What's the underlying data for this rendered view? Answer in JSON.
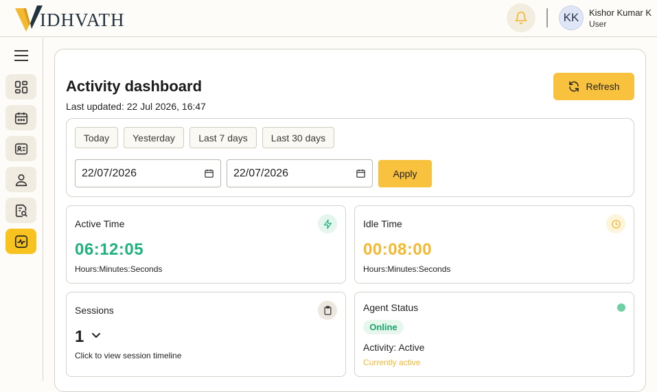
{
  "brand": {
    "logo_text": "IDHVATH",
    "logo_initial": "V"
  },
  "header": {
    "notifications_icon": "bell-icon",
    "user": {
      "initials": "KK",
      "name": "Kishor Kumar K",
      "role": "User"
    }
  },
  "sidebar": {
    "menu_icon": "hamburger-icon",
    "items": [
      {
        "icon": "dashboard-grid-icon",
        "active": false
      },
      {
        "icon": "calendar-icon",
        "active": false
      },
      {
        "icon": "id-card-icon",
        "active": false
      },
      {
        "icon": "user-icon",
        "active": false
      },
      {
        "icon": "report-search-icon",
        "active": false
      },
      {
        "icon": "activity-pulse-icon",
        "active": true
      }
    ]
  },
  "page": {
    "title": "Activity dashboard",
    "last_updated": "Last updated: 22 Jul 2026, 16:47",
    "refresh_label": "Refresh"
  },
  "filters": {
    "quick_ranges": [
      "Today",
      "Yesterday",
      "Last 7 days",
      "Last 30 days"
    ],
    "start_date": "22/07/2026",
    "end_date": "22/07/2026",
    "apply_label": "Apply"
  },
  "cards": {
    "active_time": {
      "label": "Active Time",
      "value": "06:12:05",
      "unit": "Hours:Minutes:Seconds",
      "icon": "lightning-icon"
    },
    "idle_time": {
      "label": "Idle Time",
      "value": "00:08:00",
      "unit": "Hours:Minutes:Seconds",
      "icon": "clock-icon"
    },
    "sessions": {
      "label": "Sessions",
      "value": "1",
      "hint": "Click to view session timeline",
      "icon": "clipboard-icon"
    },
    "agent_status": {
      "label": "Agent Status",
      "badge": "Online",
      "activity": "Activity: Active",
      "detail": "Currently active"
    }
  },
  "colors": {
    "accent": "#f8c13e",
    "active_green": "#20b27c",
    "idle_amber": "#f4b730",
    "online_dot": "#6fd0a6"
  }
}
